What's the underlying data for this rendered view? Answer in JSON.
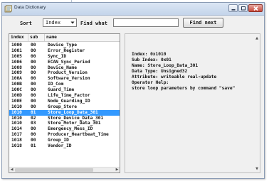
{
  "window": {
    "title": "Data Dictionary"
  },
  "toolbar": {
    "sort_label": "Sort",
    "sort_value": "Index",
    "find_label": "Find what",
    "find_value": "",
    "find_next_label": "Find next"
  },
  "list": {
    "headers": {
      "index": "index",
      "sub": "sub",
      "name": "name"
    },
    "rows": [
      {
        "index": "1000",
        "sub": "00",
        "name": "Device_Type"
      },
      {
        "index": "1001",
        "sub": "00",
        "name": "Error_Register"
      },
      {
        "index": "1005",
        "sub": "00",
        "name": "Sync_ID"
      },
      {
        "index": "1006",
        "sub": "00",
        "name": "ECAN_Sync_Period"
      },
      {
        "index": "1008",
        "sub": "00",
        "name": "Device_Name"
      },
      {
        "index": "1009",
        "sub": "00",
        "name": "Product_Version"
      },
      {
        "index": "100A",
        "sub": "00",
        "name": "Software_Version"
      },
      {
        "index": "100B",
        "sub": "00",
        "name": "ID_Com"
      },
      {
        "index": "100C",
        "sub": "00",
        "name": "Guard_Time"
      },
      {
        "index": "100D",
        "sub": "00",
        "name": "Life_Time_Factor"
      },
      {
        "index": "100E",
        "sub": "00",
        "name": "Node_Guarding_ID"
      },
      {
        "index": "1010",
        "sub": "00",
        "name": "Group_Store"
      },
      {
        "index": "1010",
        "sub": "01",
        "name": "Store_Loop_Data_301"
      },
      {
        "index": "1010",
        "sub": "02",
        "name": "Store_Device_Data_301"
      },
      {
        "index": "1010",
        "sub": "03",
        "name": "Store_Motor_Data_301"
      },
      {
        "index": "1014",
        "sub": "00",
        "name": "Emergency_Mess_ID"
      },
      {
        "index": "1017",
        "sub": "00",
        "name": "Producer_Heartbeat_Time"
      },
      {
        "index": "1018",
        "sub": "00",
        "name": "Group_ID"
      },
      {
        "index": "1018",
        "sub": "01",
        "name": "Vendor_ID"
      }
    ],
    "selected_row": 12
  },
  "detail": {
    "index_line": "Index: 0x1010",
    "sub_index_line": "Sub Index: 0x01",
    "name_line": "Name: Store_Loop_Data_301",
    "data_type_line": "Data Type: Unsigned32",
    "attribute_line": "Attribute: writeable  real-update",
    "help_label": "Operator Help:",
    "help_text": "store loop parameters by command \"save\""
  },
  "colors": {
    "selection": "#3399ff",
    "close_button": "#c9483a",
    "titlebar": "#c4d4ea"
  },
  "icons": {
    "app": "data-dictionary-icon",
    "minimize": "minimize-icon",
    "maximize": "maximize-icon",
    "close": "close-icon",
    "dropdown": "chevron-down-icon"
  }
}
